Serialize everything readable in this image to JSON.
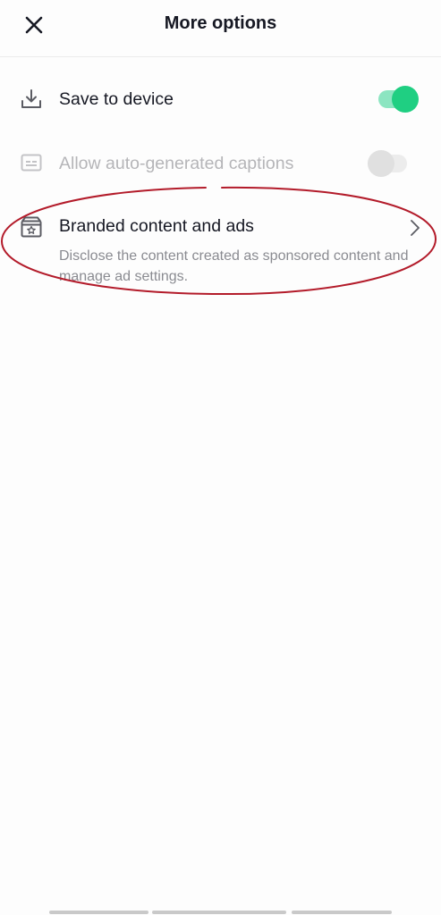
{
  "header": {
    "title": "More options",
    "close_icon": "close-icon"
  },
  "options": {
    "save_to_device": {
      "label": "Save to device",
      "icon": "download-icon",
      "toggle_on": true,
      "toggle_color": "#1fcf82"
    },
    "auto_captions": {
      "label": "Allow auto-generated captions",
      "icon": "captions-icon",
      "toggle_on": false,
      "disabled": true
    },
    "branded_content": {
      "label": "Branded content and ads",
      "description": "Disclose the content created as sponsored content and manage ad settings.",
      "icon": "branded-content-icon",
      "chevron_icon": "chevron-right-icon"
    }
  },
  "annotation": {
    "color": "#b31b2a",
    "shape": "ellipse"
  }
}
